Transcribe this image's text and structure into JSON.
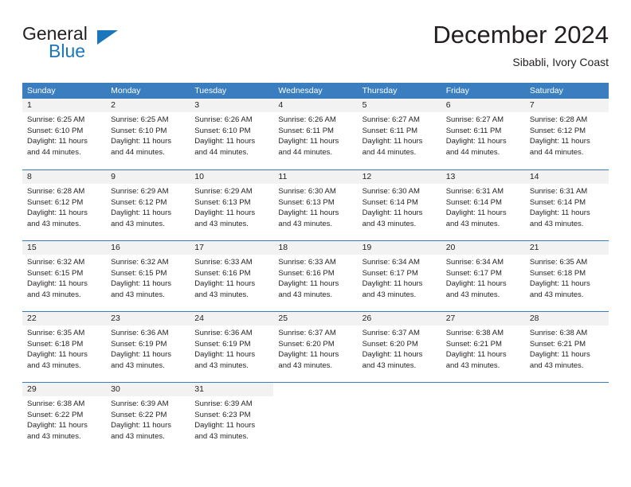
{
  "logo": {
    "line1": "General",
    "line2": "Blue",
    "triangle_color": "#1b76bc"
  },
  "header": {
    "title": "December 2024",
    "subtitle": "Sibabli, Ivory Coast"
  },
  "colors": {
    "header_blue": "#3a7ebf",
    "daynum_gray": "#f2f2f2",
    "text": "#231f20",
    "brand_blue": "#1b76bc"
  },
  "weekdays": [
    "Sunday",
    "Monday",
    "Tuesday",
    "Wednesday",
    "Thursday",
    "Friday",
    "Saturday"
  ],
  "weeks": [
    [
      {
        "day": "1",
        "sunrise": "Sunrise: 6:25 AM",
        "sunset": "Sunset: 6:10 PM",
        "daylight1": "Daylight: 11 hours",
        "daylight2": "and 44 minutes."
      },
      {
        "day": "2",
        "sunrise": "Sunrise: 6:25 AM",
        "sunset": "Sunset: 6:10 PM",
        "daylight1": "Daylight: 11 hours",
        "daylight2": "and 44 minutes."
      },
      {
        "day": "3",
        "sunrise": "Sunrise: 6:26 AM",
        "sunset": "Sunset: 6:10 PM",
        "daylight1": "Daylight: 11 hours",
        "daylight2": "and 44 minutes."
      },
      {
        "day": "4",
        "sunrise": "Sunrise: 6:26 AM",
        "sunset": "Sunset: 6:11 PM",
        "daylight1": "Daylight: 11 hours",
        "daylight2": "and 44 minutes."
      },
      {
        "day": "5",
        "sunrise": "Sunrise: 6:27 AM",
        "sunset": "Sunset: 6:11 PM",
        "daylight1": "Daylight: 11 hours",
        "daylight2": "and 44 minutes."
      },
      {
        "day": "6",
        "sunrise": "Sunrise: 6:27 AM",
        "sunset": "Sunset: 6:11 PM",
        "daylight1": "Daylight: 11 hours",
        "daylight2": "and 44 minutes."
      },
      {
        "day": "7",
        "sunrise": "Sunrise: 6:28 AM",
        "sunset": "Sunset: 6:12 PM",
        "daylight1": "Daylight: 11 hours",
        "daylight2": "and 44 minutes."
      }
    ],
    [
      {
        "day": "8",
        "sunrise": "Sunrise: 6:28 AM",
        "sunset": "Sunset: 6:12 PM",
        "daylight1": "Daylight: 11 hours",
        "daylight2": "and 43 minutes."
      },
      {
        "day": "9",
        "sunrise": "Sunrise: 6:29 AM",
        "sunset": "Sunset: 6:12 PM",
        "daylight1": "Daylight: 11 hours",
        "daylight2": "and 43 minutes."
      },
      {
        "day": "10",
        "sunrise": "Sunrise: 6:29 AM",
        "sunset": "Sunset: 6:13 PM",
        "daylight1": "Daylight: 11 hours",
        "daylight2": "and 43 minutes."
      },
      {
        "day": "11",
        "sunrise": "Sunrise: 6:30 AM",
        "sunset": "Sunset: 6:13 PM",
        "daylight1": "Daylight: 11 hours",
        "daylight2": "and 43 minutes."
      },
      {
        "day": "12",
        "sunrise": "Sunrise: 6:30 AM",
        "sunset": "Sunset: 6:14 PM",
        "daylight1": "Daylight: 11 hours",
        "daylight2": "and 43 minutes."
      },
      {
        "day": "13",
        "sunrise": "Sunrise: 6:31 AM",
        "sunset": "Sunset: 6:14 PM",
        "daylight1": "Daylight: 11 hours",
        "daylight2": "and 43 minutes."
      },
      {
        "day": "14",
        "sunrise": "Sunrise: 6:31 AM",
        "sunset": "Sunset: 6:14 PM",
        "daylight1": "Daylight: 11 hours",
        "daylight2": "and 43 minutes."
      }
    ],
    [
      {
        "day": "15",
        "sunrise": "Sunrise: 6:32 AM",
        "sunset": "Sunset: 6:15 PM",
        "daylight1": "Daylight: 11 hours",
        "daylight2": "and 43 minutes."
      },
      {
        "day": "16",
        "sunrise": "Sunrise: 6:32 AM",
        "sunset": "Sunset: 6:15 PM",
        "daylight1": "Daylight: 11 hours",
        "daylight2": "and 43 minutes."
      },
      {
        "day": "17",
        "sunrise": "Sunrise: 6:33 AM",
        "sunset": "Sunset: 6:16 PM",
        "daylight1": "Daylight: 11 hours",
        "daylight2": "and 43 minutes."
      },
      {
        "day": "18",
        "sunrise": "Sunrise: 6:33 AM",
        "sunset": "Sunset: 6:16 PM",
        "daylight1": "Daylight: 11 hours",
        "daylight2": "and 43 minutes."
      },
      {
        "day": "19",
        "sunrise": "Sunrise: 6:34 AM",
        "sunset": "Sunset: 6:17 PM",
        "daylight1": "Daylight: 11 hours",
        "daylight2": "and 43 minutes."
      },
      {
        "day": "20",
        "sunrise": "Sunrise: 6:34 AM",
        "sunset": "Sunset: 6:17 PM",
        "daylight1": "Daylight: 11 hours",
        "daylight2": "and 43 minutes."
      },
      {
        "day": "21",
        "sunrise": "Sunrise: 6:35 AM",
        "sunset": "Sunset: 6:18 PM",
        "daylight1": "Daylight: 11 hours",
        "daylight2": "and 43 minutes."
      }
    ],
    [
      {
        "day": "22",
        "sunrise": "Sunrise: 6:35 AM",
        "sunset": "Sunset: 6:18 PM",
        "daylight1": "Daylight: 11 hours",
        "daylight2": "and 43 minutes."
      },
      {
        "day": "23",
        "sunrise": "Sunrise: 6:36 AM",
        "sunset": "Sunset: 6:19 PM",
        "daylight1": "Daylight: 11 hours",
        "daylight2": "and 43 minutes."
      },
      {
        "day": "24",
        "sunrise": "Sunrise: 6:36 AM",
        "sunset": "Sunset: 6:19 PM",
        "daylight1": "Daylight: 11 hours",
        "daylight2": "and 43 minutes."
      },
      {
        "day": "25",
        "sunrise": "Sunrise: 6:37 AM",
        "sunset": "Sunset: 6:20 PM",
        "daylight1": "Daylight: 11 hours",
        "daylight2": "and 43 minutes."
      },
      {
        "day": "26",
        "sunrise": "Sunrise: 6:37 AM",
        "sunset": "Sunset: 6:20 PM",
        "daylight1": "Daylight: 11 hours",
        "daylight2": "and 43 minutes."
      },
      {
        "day": "27",
        "sunrise": "Sunrise: 6:38 AM",
        "sunset": "Sunset: 6:21 PM",
        "daylight1": "Daylight: 11 hours",
        "daylight2": "and 43 minutes."
      },
      {
        "day": "28",
        "sunrise": "Sunrise: 6:38 AM",
        "sunset": "Sunset: 6:21 PM",
        "daylight1": "Daylight: 11 hours",
        "daylight2": "and 43 minutes."
      }
    ],
    [
      {
        "day": "29",
        "sunrise": "Sunrise: 6:38 AM",
        "sunset": "Sunset: 6:22 PM",
        "daylight1": "Daylight: 11 hours",
        "daylight2": "and 43 minutes."
      },
      {
        "day": "30",
        "sunrise": "Sunrise: 6:39 AM",
        "sunset": "Sunset: 6:22 PM",
        "daylight1": "Daylight: 11 hours",
        "daylight2": "and 43 minutes."
      },
      {
        "day": "31",
        "sunrise": "Sunrise: 6:39 AM",
        "sunset": "Sunset: 6:23 PM",
        "daylight1": "Daylight: 11 hours",
        "daylight2": "and 43 minutes."
      },
      {
        "day": "",
        "sunrise": "",
        "sunset": "",
        "daylight1": "",
        "daylight2": ""
      },
      {
        "day": "",
        "sunrise": "",
        "sunset": "",
        "daylight1": "",
        "daylight2": ""
      },
      {
        "day": "",
        "sunrise": "",
        "sunset": "",
        "daylight1": "",
        "daylight2": ""
      },
      {
        "day": "",
        "sunrise": "",
        "sunset": "",
        "daylight1": "",
        "daylight2": ""
      }
    ]
  ]
}
